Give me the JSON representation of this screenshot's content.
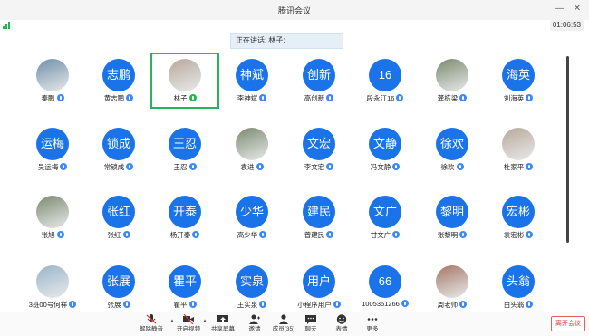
{
  "window": {
    "title": "腾讯会议",
    "minimize_glyph": "—",
    "close_glyph": "✕"
  },
  "status": {
    "timer": "01:06:53"
  },
  "speaking": {
    "label": "正在讲话:",
    "speaker": "林子;"
  },
  "participants": [
    [
      {
        "avatar_text": "",
        "photo": true,
        "name": "秦鹏",
        "mic": "blue"
      },
      {
        "avatar_text": "志鹏",
        "name": "黄志鹏",
        "mic": "blue"
      },
      {
        "avatar_text": "",
        "photo": true,
        "name": "林子",
        "mic": "green",
        "selected": true
      },
      {
        "avatar_text": "神斌",
        "name": "李神斌",
        "mic": "blue"
      },
      {
        "avatar_text": "创新",
        "name": "高创新",
        "mic": "blue"
      },
      {
        "avatar_text": "16",
        "name": "段永江16",
        "mic": "blue"
      },
      {
        "avatar_text": "",
        "photo": true,
        "name": "龚栋梁",
        "mic": "blue"
      },
      {
        "avatar_text": "海英",
        "name": "刘海英",
        "mic": "blue"
      }
    ],
    [
      {
        "avatar_text": "运梅",
        "name": "吴运梅",
        "mic": "blue"
      },
      {
        "avatar_text": "锁成",
        "name": "常锁成",
        "mic": "blue"
      },
      {
        "avatar_text": "王忍",
        "name": "王忍",
        "mic": "blue"
      },
      {
        "avatar_text": "",
        "photo": true,
        "name": "袁进",
        "mic": "blue"
      },
      {
        "avatar_text": "文宏",
        "name": "李文宏",
        "mic": "blue"
      },
      {
        "avatar_text": "文静",
        "name": "冯文静",
        "mic": "blue"
      },
      {
        "avatar_text": "徐欢",
        "name": "徐欢",
        "mic": "blue"
      },
      {
        "avatar_text": "",
        "photo": true,
        "name": "杜家平",
        "mic": "blue"
      }
    ],
    [
      {
        "avatar_text": "",
        "photo": true,
        "name": "张旭",
        "mic": "blue"
      },
      {
        "avatar_text": "张红",
        "name": "张红",
        "mic": "blue"
      },
      {
        "avatar_text": "开泰",
        "name": "杨开泰",
        "mic": "blue"
      },
      {
        "avatar_text": "少华",
        "name": "高少华",
        "mic": "blue"
      },
      {
        "avatar_text": "建民",
        "name": "曾建民",
        "mic": "blue"
      },
      {
        "avatar_text": "文广",
        "name": "甘文广",
        "mic": "blue"
      },
      {
        "avatar_text": "黎明",
        "name": "张黎明",
        "mic": "blue"
      },
      {
        "avatar_text": "宏彬",
        "name": "袁宏彬",
        "mic": "blue"
      }
    ],
    [
      {
        "avatar_text": "",
        "photo": true,
        "name": "3班00号何祥",
        "mic": "blue"
      },
      {
        "avatar_text": "张展",
        "name": "张展",
        "mic": "blue"
      },
      {
        "avatar_text": "瞿平",
        "name": "瞿平",
        "mic": "blue"
      },
      {
        "avatar_text": "实泉",
        "name": "王实泉",
        "mic": "blue"
      },
      {
        "avatar_text": "用户",
        "name": "小程序用户",
        "mic": "blue"
      },
      {
        "avatar_text": "66",
        "name": "1005351266",
        "mic": "blue"
      },
      {
        "avatar_text": "",
        "photo": true,
        "name": "周老师",
        "mic": "blue"
      },
      {
        "avatar_text": "头翁",
        "name": "白头翁",
        "mic": "blue"
      }
    ]
  ],
  "toolbar": {
    "items": [
      {
        "label": "解除静音",
        "icon": "mic-muted-icon"
      },
      {
        "label": "开启视频",
        "icon": "video-off-icon"
      },
      {
        "label": "共享屏幕",
        "icon": "screen-share-icon"
      },
      {
        "label": "邀请",
        "icon": "invite-icon"
      },
      {
        "label": "成员(35)",
        "icon": "members-icon"
      },
      {
        "label": "聊天",
        "icon": "chat-icon"
      },
      {
        "label": "表情",
        "icon": "emoji-icon"
      },
      {
        "label": "更多",
        "icon": "more-icon"
      }
    ],
    "leave_label": "离开会议"
  }
}
